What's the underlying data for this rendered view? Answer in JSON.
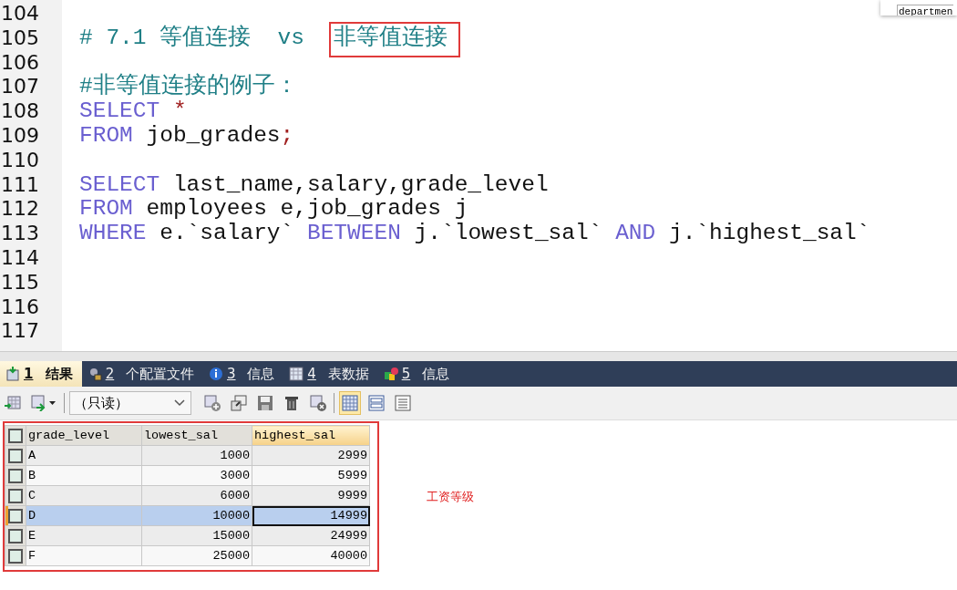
{
  "tooltip": {
    "text": "departmen"
  },
  "editor": {
    "lines": [
      {
        "number": "104"
      },
      {
        "number": "105",
        "tokens": [
          {
            "text": "# 7.1 等值连接  vs  ",
            "kind": "comment"
          },
          {
            "text": "非等值连接",
            "kind": "boxed-comment"
          }
        ]
      },
      {
        "number": "106"
      },
      {
        "number": "107",
        "tokens": [
          {
            "text": "#非等值连接的例子：",
            "kind": "comment"
          }
        ]
      },
      {
        "number": "108",
        "tokens": [
          {
            "text": "SELECT",
            "kind": "keyword"
          },
          {
            "text": " *",
            "kind": "operator"
          }
        ]
      },
      {
        "number": "109",
        "tokens": [
          {
            "text": "FROM",
            "kind": "keyword"
          },
          {
            "text": " job_grades",
            "kind": "plain"
          },
          {
            "text": ";",
            "kind": "operator"
          }
        ]
      },
      {
        "number": "110"
      },
      {
        "number": "111",
        "tokens": [
          {
            "text": "SELECT",
            "kind": "keyword"
          },
          {
            "text": " last_name,salary,grade_level",
            "kind": "plain"
          }
        ]
      },
      {
        "number": "112",
        "tokens": [
          {
            "text": "FROM",
            "kind": "keyword"
          },
          {
            "text": " employees e,job_grades j",
            "kind": "plain"
          }
        ]
      },
      {
        "number": "113",
        "tokens": [
          {
            "text": "WHERE",
            "kind": "keyword"
          },
          {
            "text": " e.`salary` ",
            "kind": "plain"
          },
          {
            "text": "BETWEEN",
            "kind": "keyword"
          },
          {
            "text": " j.`lowest_sal` ",
            "kind": "plain"
          },
          {
            "text": "AND",
            "kind": "keyword"
          },
          {
            "text": " j.`highest_sal`",
            "kind": "plain"
          }
        ]
      },
      {
        "number": "114"
      },
      {
        "number": "115"
      },
      {
        "number": "116"
      },
      {
        "number": "117"
      }
    ]
  },
  "tabs": [
    {
      "number": "1",
      "label": "结果",
      "selected": true
    },
    {
      "number": "2",
      "label": "个配置文件",
      "selected": false
    },
    {
      "number": "3",
      "label": "信息",
      "selected": false
    },
    {
      "number": "4",
      "label": "表数据",
      "selected": false
    },
    {
      "number": "5",
      "label": "信息",
      "selected": false
    }
  ],
  "toolbar": {
    "mode": "（只读）",
    "views": [
      {
        "kind": "grid",
        "selected": true
      },
      {
        "kind": "form",
        "selected": false
      },
      {
        "kind": "text",
        "selected": false
      }
    ]
  },
  "grid": {
    "all_checked": false,
    "columns": [
      {
        "name": "grade_level",
        "selected": false
      },
      {
        "name": "lowest_sal",
        "selected": false
      },
      {
        "name": "highest_sal",
        "selected": true
      }
    ],
    "rows": [
      {
        "cells": [
          "A",
          "1000",
          "2999"
        ],
        "checked": false,
        "selected": false
      },
      {
        "cells": [
          "B",
          "3000",
          "5999"
        ],
        "checked": false,
        "selected": false
      },
      {
        "cells": [
          "C",
          "6000",
          "9999"
        ],
        "checked": false,
        "selected": false
      },
      {
        "cells": [
          "D",
          "10000",
          "14999"
        ],
        "checked": false,
        "selected": true
      },
      {
        "cells": [
          "E",
          "15000",
          "24999"
        ],
        "checked": false,
        "selected": false
      },
      {
        "cells": [
          "F",
          "25000",
          "40000"
        ],
        "checked": false,
        "selected": false
      }
    ]
  },
  "annotation": {
    "text": "工资等级"
  }
}
